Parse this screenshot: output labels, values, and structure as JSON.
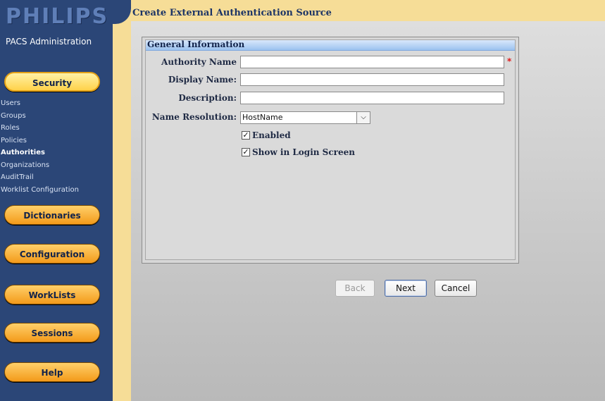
{
  "sidebar": {
    "logo": "PHILIPS",
    "app_title": "PACS Administration",
    "security": "Security",
    "sub_items": [
      "Users",
      "Groups",
      "Roles",
      "Policies",
      "Authorities",
      "Organizations",
      "AuditTrail",
      "Worklist Configuration"
    ],
    "active_sub_item": "Authorities",
    "dictionaries": "Dictionaries",
    "configuration": "Configuration",
    "worklists": "WorkLists",
    "sessions": "Sessions",
    "help": "Help"
  },
  "header": {
    "title": "Create External Authentication Source"
  },
  "form": {
    "section_title": "General Information",
    "authority_name_label": "Authority Name",
    "authority_name_value": "",
    "display_name_label": "Display Name:",
    "display_name_value": "",
    "description_label": "Description:",
    "description_value": "",
    "name_resolution_label": "Name Resolution:",
    "name_resolution_value": "HostName",
    "enabled_label": "Enabled",
    "enabled_checked": true,
    "show_login_label": "Show in Login Screen",
    "show_login_checked": true,
    "required_marker": "*"
  },
  "buttons": {
    "back": "Back",
    "next": "Next",
    "cancel": "Cancel"
  },
  "colors": {
    "sidebar": "#2b4677",
    "accent": "#f39a1a",
    "header_band": "#f6dd97"
  }
}
